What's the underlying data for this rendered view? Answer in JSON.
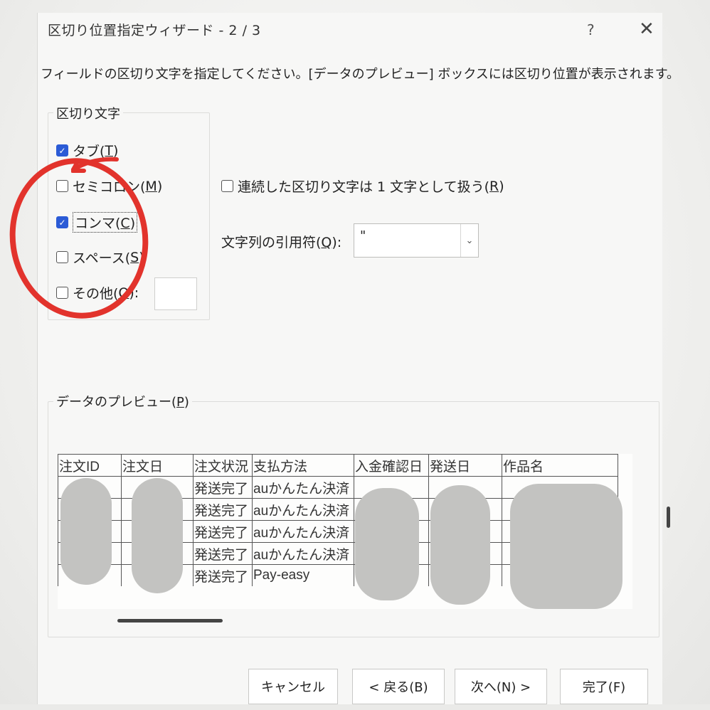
{
  "title": "区切り位置指定ウィザード - 2 / 3",
  "help": "?",
  "close": "✕",
  "instruction": "フィールドの区切り文字を指定してください。[データのプレビュー] ボックスには区切り位置が表示されます。",
  "delimiters": {
    "label": "区切り文字",
    "items": [
      {
        "text": "タブ(",
        "key": "T",
        "close": ")",
        "checked": true
      },
      {
        "text": "セミコロン(",
        "key": "M",
        "close": ")",
        "checked": false
      },
      {
        "text": "コンマ(",
        "key": "C",
        "close": ")",
        "checked": true
      },
      {
        "text": "スペース(",
        "key": "S",
        "close": ")",
        "checked": false
      },
      {
        "text": "その他(",
        "key": "O",
        "close": "):",
        "checked": false
      }
    ]
  },
  "consecutive": {
    "text": "連続した区切り文字は 1 文字として扱う(",
    "key": "R",
    "close": ")"
  },
  "qualifier": {
    "label": "文字列の引用符(",
    "key": "Q",
    "close": "):",
    "value": "\"",
    "arrow": "⌄"
  },
  "preview": {
    "label": "データのプレビュー(",
    "key": "P",
    "close": ")",
    "headers": [
      "注文ID",
      "注文日",
      "注文状況",
      "支払方法",
      "入金確認日",
      "発送日",
      "作品名"
    ],
    "rows": [
      [
        "",
        "",
        "発送完了",
        "auかんたん決済",
        "",
        "",
        ""
      ],
      [
        "",
        "",
        "発送完了",
        "auかんたん決済",
        "",
        "",
        ""
      ],
      [
        "",
        "",
        "発送完了",
        "auかんたん決済",
        "",
        "",
        ""
      ],
      [
        "",
        "",
        "発送完了",
        "auかんたん決済",
        "",
        "",
        ""
      ],
      [
        "",
        "",
        "発送完了",
        "Pay-easy",
        "",
        "",
        ""
      ]
    ]
  },
  "buttons": {
    "cancel": "キャンセル",
    "back": "< 戻る(B)",
    "next": "次へ(N) >",
    "finish": "完了(F)"
  },
  "colors": {
    "accent": "#2b5bd6",
    "annotation": "#e2332c"
  }
}
